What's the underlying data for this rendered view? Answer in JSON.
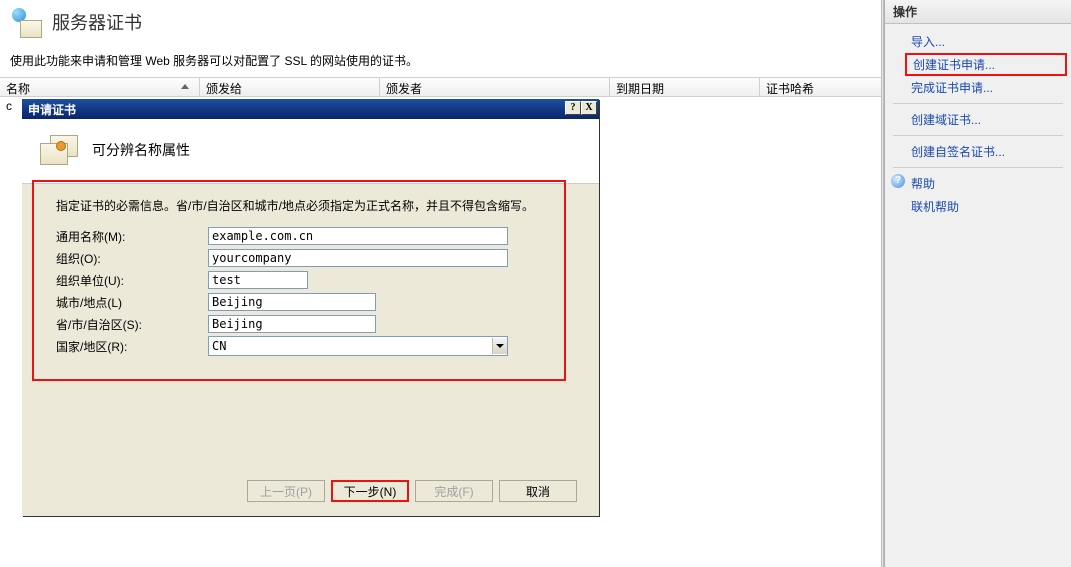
{
  "page": {
    "title": "服务器证书",
    "subtitle": "使用此功能来申请和管理 Web 服务器可以对配置了 SSL 的网站使用的证书。"
  },
  "table": {
    "cols": {
      "c1": "名称",
      "c2": "颁发给",
      "c3": "颁发者",
      "c4": "到期日期",
      "c5": "证书哈希"
    },
    "row0": "c"
  },
  "dialog": {
    "title": "申请证书",
    "header": "可分辨名称属性",
    "hint": "指定证书的必需信息。省/市/自治区和城市/地点必须指定为正式名称，并且不得包含缩写。",
    "labels": {
      "cn": "通用名称(M):",
      "org": "组织(O):",
      "ou": "组织单位(U):",
      "city": "城市/地点(L)",
      "state": "省/市/自治区(S):",
      "country": "国家/地区(R):"
    },
    "values": {
      "cn": "example.com.cn",
      "org": "yourcompany",
      "ou": "test",
      "city": "Beijing",
      "state": "Beijing",
      "country": "CN"
    },
    "buttons": {
      "prev": "上一页(P)",
      "next": "下一步(N)",
      "finish": "完成(F)",
      "cancel": "取消"
    },
    "tb": {
      "help": "?",
      "close": "X"
    }
  },
  "actions": {
    "head": "操作",
    "items": {
      "import": "导入...",
      "createReq": "创建证书申请...",
      "completeReq": "完成证书申请...",
      "domain": "创建域证书...",
      "selfsign": "创建自签名证书...",
      "help": "帮助",
      "onlineHelp": "联机帮助"
    }
  }
}
